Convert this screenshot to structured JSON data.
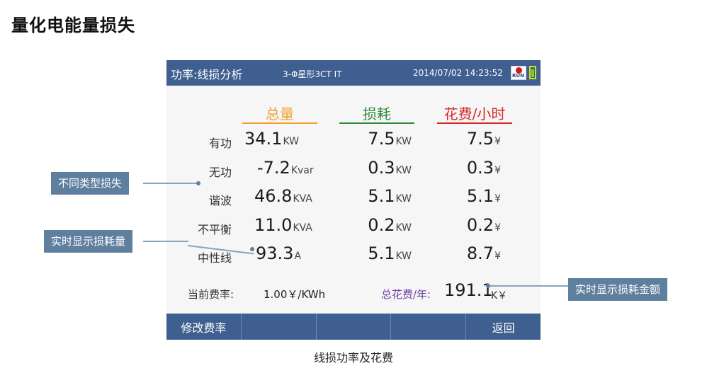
{
  "page_title": "量化电能量损失",
  "screen": {
    "mode": "功率:线损分析",
    "wiring": "3-Φ星形3CT IT",
    "datetime": "2014/07/02 14:23:52",
    "run_badge": "RUN",
    "columns": [
      {
        "label": "总量",
        "color": "#f0a030"
      },
      {
        "label": "损耗",
        "color": "#2e8b3e"
      },
      {
        "label": "花费/小时",
        "color": "#d42a2a"
      }
    ],
    "rows": [
      {
        "label": "有功",
        "total": "34.1",
        "total_unit": "KW",
        "loss": "7.5",
        "loss_unit": "KW",
        "cost": "7.5",
        "cost_unit": "¥"
      },
      {
        "label": "无功",
        "total": "-7.2",
        "total_unit": "Kvar",
        "loss": "0.3",
        "loss_unit": "KW",
        "cost": "0.3",
        "cost_unit": "¥"
      },
      {
        "label": "谐波",
        "total": "46.8",
        "total_unit": "KVA",
        "loss": "5.1",
        "loss_unit": "KW",
        "cost": "5.1",
        "cost_unit": "¥"
      },
      {
        "label": "不平衡",
        "total": "11.0",
        "total_unit": "KVA",
        "loss": "0.2",
        "loss_unit": "KW",
        "cost": "0.2",
        "cost_unit": "¥"
      },
      {
        "label": "中性线",
        "total": "93.3",
        "total_unit": "A",
        "loss": "5.1",
        "loss_unit": "KW",
        "cost": "8.7",
        "cost_unit": "¥"
      }
    ],
    "rate_label": "当前费率:",
    "rate_value": "1.00￥/KWh",
    "total_cost_label": "总花费/年:",
    "total_cost_value": "191.1",
    "total_cost_unit": "K￥",
    "softkeys": [
      "修改费率",
      "",
      "",
      "",
      "返回"
    ]
  },
  "callouts": {
    "loss_types": "不同类型损失",
    "realtime_loss": "实时显示损耗量",
    "realtime_cost": "实时显示损耗金额"
  },
  "caption": "线损功率及花费"
}
